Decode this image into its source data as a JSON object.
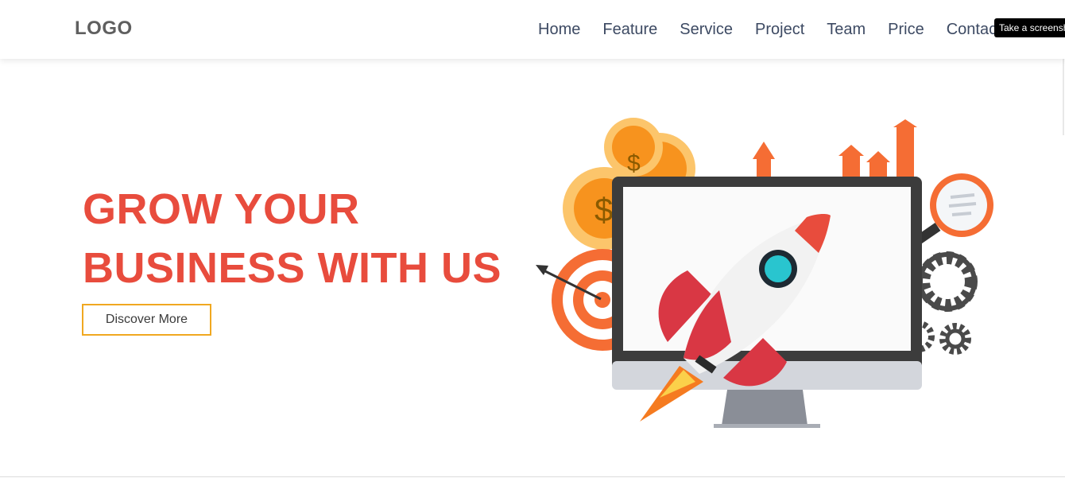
{
  "nav": {
    "logo": "LOGO",
    "links": [
      "Home",
      "Feature",
      "Service",
      "Project",
      "Team",
      "Price",
      "Contact"
    ]
  },
  "tooltip": "Take a screenshot",
  "hero": {
    "title_line1": "GROW YOUR",
    "title_line2": "BUSINESS WITH US",
    "button_label": "Discover More"
  },
  "illustration": {
    "coin_symbol": "$"
  },
  "colors": {
    "accent": "#e84c3d",
    "button_border": "#f0a820",
    "nav_text": "#3d4a63",
    "logo_text": "#5f5f5f"
  }
}
